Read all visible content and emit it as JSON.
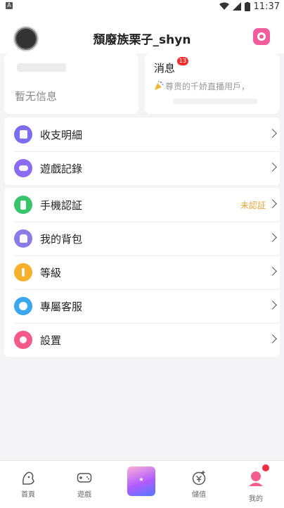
{
  "status_bar": {
    "left_badge": "A",
    "time": "11:37"
  },
  "header": {
    "username": "頹廢族栗子_shyn"
  },
  "cards": {
    "left": {
      "empty_text": "暫无信息"
    },
    "right": {
      "title": "消息",
      "badge": "13",
      "preview": "尊贵的千娇直播用戶，"
    }
  },
  "menu_group_1": [
    {
      "label": "收支明細",
      "icon": "receipt-icon",
      "color": "#7b6cf0"
    },
    {
      "label": "遊戲記錄",
      "icon": "gamepad-icon",
      "color": "#8a6cf2"
    }
  ],
  "menu_group_2": [
    {
      "label": "手機認証",
      "status": "未認証",
      "icon": "phone-icon",
      "color": "#37c46a"
    },
    {
      "label": "我的背包",
      "icon": "backpack-icon",
      "color": "#8a7ce8"
    },
    {
      "label": "等級",
      "icon": "level-icon",
      "color": "#f5b12b"
    },
    {
      "label": "專屬客服",
      "icon": "support-icon",
      "color": "#3aa7ef"
    },
    {
      "label": "設置",
      "icon": "settings-icon",
      "color": "#f35a8a"
    }
  ],
  "tabbar": [
    {
      "label": "首頁",
      "icon": "home-mascot-icon"
    },
    {
      "label": "遊戲",
      "icon": "game-controller-icon"
    },
    {
      "label": "",
      "icon": "promo-banner-icon"
    },
    {
      "label": "儲值",
      "icon": "recharge-icon"
    },
    {
      "label": "我的",
      "icon": "profile-icon"
    }
  ],
  "colors": {
    "accent": "#f05c9c",
    "status_pending": "#e8a53a",
    "badge_red": "#f03030"
  }
}
